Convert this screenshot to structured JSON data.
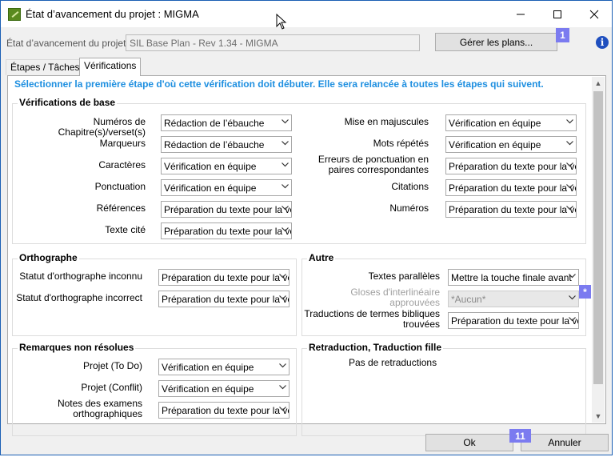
{
  "window": {
    "title": "État d’avancement du projet : MIGMA",
    "minimize_icon": "minimize-icon",
    "maximize_icon": "maximize-icon",
    "close_icon": "close-icon"
  },
  "project": {
    "label": "État d’avancement du projet :",
    "value": "SIL Base Plan - Rev 1.34 - MIGMA",
    "manage_button": "Gérer les plans...",
    "badge": "1"
  },
  "tabs": [
    {
      "label": "Étapes / Tâches"
    },
    {
      "label": "Vérifications"
    }
  ],
  "instruction": "Sélectionner la première étape d'où cette vérification doit débuter. Elle sera relancée à toutes les étapes qui suivent.",
  "basic": {
    "title": "Vérifications de base",
    "left": [
      {
        "label": "Numéros de Chapitre(s)/verset(s)",
        "value": "Rédaction de l’ébauche"
      },
      {
        "label": "Marqueurs",
        "value": "Rédaction de l’ébauche"
      },
      {
        "label": "Caractères",
        "value": "Vérification en équipe"
      },
      {
        "label": "Ponctuation",
        "value": "Vérification en équipe"
      },
      {
        "label": "Références",
        "value": "Préparation du texte pour la vé"
      },
      {
        "label": "Texte cité",
        "value": "Préparation du texte pour la vé"
      }
    ],
    "right": [
      {
        "label": "Mise en majuscules",
        "value": "Vérification en équipe"
      },
      {
        "label": "Mots répétés",
        "value": "Vérification en équipe"
      },
      {
        "label": "Erreurs de ponctuation en paires correspondantes",
        "value": "Préparation du texte pour la vé"
      },
      {
        "label": "Citations",
        "value": "Préparation du texte pour la vé"
      },
      {
        "label": "Numéros",
        "value": "Préparation du texte pour la vé"
      }
    ]
  },
  "spelling": {
    "title": "Orthographe",
    "rows": [
      {
        "label": "Statut d'orthographe inconnu",
        "value": "Préparation du texte pour la vé"
      },
      {
        "label": "Statut d'orthographe incorrect",
        "value": "Préparation du texte pour la vé"
      }
    ]
  },
  "other": {
    "title": "Autre",
    "rows": [
      {
        "label": "Textes parallèles",
        "value": "Mettre la touche finale avant"
      },
      {
        "label": "Gloses d'interlinéaire approuvées",
        "value": "*Aucun*"
      },
      {
        "label": "Traductions de termes bibliques trouvées",
        "value": "Préparation du texte pour la vé"
      }
    ],
    "badge": "*"
  },
  "notes": {
    "title": "Remarques non résolues",
    "rows": [
      {
        "label": "Projet (To Do)",
        "value": "Vérification en équipe"
      },
      {
        "label": "Projet (Conflit)",
        "value": "Vérification en équipe"
      },
      {
        "label": "Notes des examens orthographiques",
        "value": "Préparation du texte pour la vé"
      }
    ]
  },
  "backtrans": {
    "title": "Retraduction, Traduction fille",
    "empty": "Pas de retraductions"
  },
  "footer": {
    "ok": "Ok",
    "cancel": "Annuler",
    "badge": "11"
  }
}
